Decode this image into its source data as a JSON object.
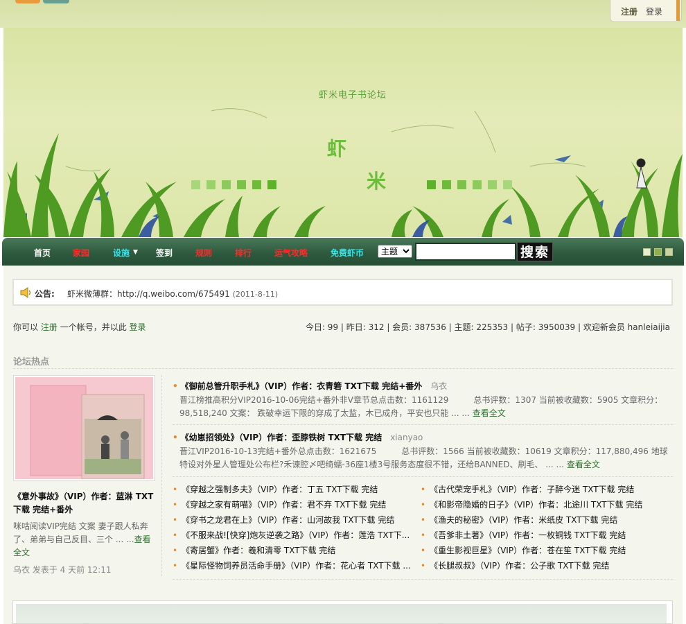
{
  "header": {
    "register_label": "注册",
    "login_label": "登录"
  },
  "banner": {
    "site_name": "虾米电子书论坛",
    "char1": "虾",
    "char2": "米"
  },
  "nav": {
    "items": [
      {
        "label": "首页",
        "color": "#ffffff"
      },
      {
        "label": "家园",
        "color": "#ff2a2a"
      },
      {
        "label": "设施",
        "color": "#33e6f0"
      },
      {
        "label": "签到",
        "color": "#ffffff"
      },
      {
        "label": "规则",
        "color": "#ff2a2a"
      },
      {
        "label": "排行",
        "color": "#ff2a2a"
      },
      {
        "label": "运气攻略",
        "color": "#ff2a2a"
      },
      {
        "label": "免费虾币",
        "color": "#33e6f0"
      }
    ],
    "search_type": "主题",
    "search_button": "搜索"
  },
  "notice": {
    "label": "公告:",
    "text": "虾米微薄群：http://q.weibo.com/675491",
    "date": "(2011-8-11)"
  },
  "welcome": {
    "prefix": "你可以",
    "register": "注册",
    "middle": "一个帐号，并以此",
    "login": "登录"
  },
  "stats": {
    "text": "今日: 99 | 昨日: 312 | 会员: 387536 | 主题: 225353 | 帖子: 3950039 | 欢迎新会员",
    "new_member": "hanleiaijia"
  },
  "hot": {
    "title": "论坛热点",
    "featured": {
      "title": "《意外事故》（VIP）作者：蓝淋 TXT下载 完结+番外",
      "desc": "咪咕阅读VIP完结 文案 妻子跟人私奔了、弟弟与自己反目、三个 ... ...",
      "read_more": "查看全文",
      "meta": "乌衣 发表于 4 天前 12:11"
    },
    "posts": [
      {
        "title": "《御前总管升职手札》（VIP）作者：衣青箬 TXT下载 完结+番外",
        "author": "乌衣",
        "body": "晋江榜推高积分VIP2016-10-06完结+番外非V章节总点击数：1161129　　　总书评数：1307 当前被收藏数：5905 文章积分：98,518,240 文案：  跌破幸运下限的穿成了太监，木已成舟，平安也只能 ... ...",
        "read_more": "查看全文"
      },
      {
        "title": "《幼崽招领处》（VIP）作者：歪脖铁树 TXT下载 完结",
        "author": "xianyao",
        "body": "晋江VIP2016-10-13完结+番外总点击数：1621675　　　总书评数：1566 当前被收藏数：10619 文章积分：117,880,496 地球特设对外星人管理处公布栏?禾谏腔〆吧绮蠕-36座1楼3号服务态度很不错，还给BANNED、刷毛、 ... ...",
        "read_more": "查看全文"
      }
    ],
    "list_left": [
      "《穿越之强制多夫》（VIP）作者：丁五 TXT下载 完结",
      "《穿越之家有萌喵》（VIP）作者：君不弃 TXT下载 完结",
      "《穿书之龙君在上》（VIP）作者：山河故我 TXT下载 完结",
      "《不服来战![快穿]炮灰逆袭之路》（VIP）作者：莲浩 TXT下...",
      "《寄居蟹》作者：羲和清零 TXT下载 完结",
      "《星际怪物饲养员活命手册》（VIP）作者：花心者 TXT下载 ..."
    ],
    "list_right": [
      "《古代荣宠手札》（VIP）作者：子醉今迷 TXT下载 完结",
      "《和影帝隐婚的日子》（VIP）作者：北途川 TXT下载 完结",
      "《渔夫的秘密》（VIP）作者：米纸皮 TXT下载 完结",
      "《吾爹非土著》（VIP）作者：一枚铜钱 TXT下载 完结",
      "《重生影视巨星》（VIP）作者：苍在笙 TXT下载 完结",
      "《长腿叔叔》（VIP）作者：公子歌 TXT下载 完结"
    ]
  },
  "colors": {
    "accent_orange": "#e88a2c",
    "nav_green": "#2e5a3e",
    "link_green": "#2f6e2f"
  }
}
